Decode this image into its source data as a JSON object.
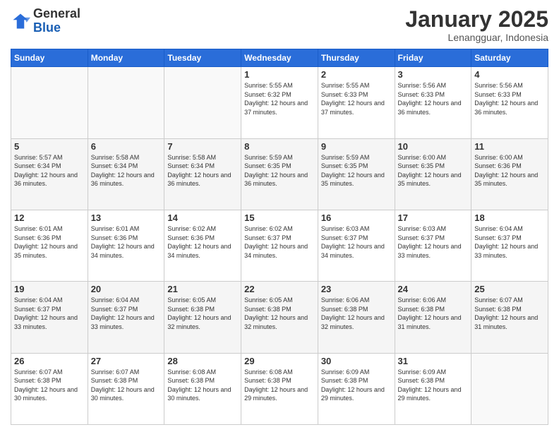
{
  "logo": {
    "general": "General",
    "blue": "Blue"
  },
  "header": {
    "month": "January 2025",
    "location": "Lenangguar, Indonesia"
  },
  "weekdays": [
    "Sunday",
    "Monday",
    "Tuesday",
    "Wednesday",
    "Thursday",
    "Friday",
    "Saturday"
  ],
  "weeks": [
    [
      {
        "day": "",
        "sunrise": "",
        "sunset": "",
        "daylight": ""
      },
      {
        "day": "",
        "sunrise": "",
        "sunset": "",
        "daylight": ""
      },
      {
        "day": "",
        "sunrise": "",
        "sunset": "",
        "daylight": ""
      },
      {
        "day": "1",
        "sunrise": "Sunrise: 5:55 AM",
        "sunset": "Sunset: 6:32 PM",
        "daylight": "Daylight: 12 hours and 37 minutes."
      },
      {
        "day": "2",
        "sunrise": "Sunrise: 5:55 AM",
        "sunset": "Sunset: 6:33 PM",
        "daylight": "Daylight: 12 hours and 37 minutes."
      },
      {
        "day": "3",
        "sunrise": "Sunrise: 5:56 AM",
        "sunset": "Sunset: 6:33 PM",
        "daylight": "Daylight: 12 hours and 36 minutes."
      },
      {
        "day": "4",
        "sunrise": "Sunrise: 5:56 AM",
        "sunset": "Sunset: 6:33 PM",
        "daylight": "Daylight: 12 hours and 36 minutes."
      }
    ],
    [
      {
        "day": "5",
        "sunrise": "Sunrise: 5:57 AM",
        "sunset": "Sunset: 6:34 PM",
        "daylight": "Daylight: 12 hours and 36 minutes."
      },
      {
        "day": "6",
        "sunrise": "Sunrise: 5:58 AM",
        "sunset": "Sunset: 6:34 PM",
        "daylight": "Daylight: 12 hours and 36 minutes."
      },
      {
        "day": "7",
        "sunrise": "Sunrise: 5:58 AM",
        "sunset": "Sunset: 6:34 PM",
        "daylight": "Daylight: 12 hours and 36 minutes."
      },
      {
        "day": "8",
        "sunrise": "Sunrise: 5:59 AM",
        "sunset": "Sunset: 6:35 PM",
        "daylight": "Daylight: 12 hours and 36 minutes."
      },
      {
        "day": "9",
        "sunrise": "Sunrise: 5:59 AM",
        "sunset": "Sunset: 6:35 PM",
        "daylight": "Daylight: 12 hours and 35 minutes."
      },
      {
        "day": "10",
        "sunrise": "Sunrise: 6:00 AM",
        "sunset": "Sunset: 6:35 PM",
        "daylight": "Daylight: 12 hours and 35 minutes."
      },
      {
        "day": "11",
        "sunrise": "Sunrise: 6:00 AM",
        "sunset": "Sunset: 6:36 PM",
        "daylight": "Daylight: 12 hours and 35 minutes."
      }
    ],
    [
      {
        "day": "12",
        "sunrise": "Sunrise: 6:01 AM",
        "sunset": "Sunset: 6:36 PM",
        "daylight": "Daylight: 12 hours and 35 minutes."
      },
      {
        "day": "13",
        "sunrise": "Sunrise: 6:01 AM",
        "sunset": "Sunset: 6:36 PM",
        "daylight": "Daylight: 12 hours and 34 minutes."
      },
      {
        "day": "14",
        "sunrise": "Sunrise: 6:02 AM",
        "sunset": "Sunset: 6:36 PM",
        "daylight": "Daylight: 12 hours and 34 minutes."
      },
      {
        "day": "15",
        "sunrise": "Sunrise: 6:02 AM",
        "sunset": "Sunset: 6:37 PM",
        "daylight": "Daylight: 12 hours and 34 minutes."
      },
      {
        "day": "16",
        "sunrise": "Sunrise: 6:03 AM",
        "sunset": "Sunset: 6:37 PM",
        "daylight": "Daylight: 12 hours and 34 minutes."
      },
      {
        "day": "17",
        "sunrise": "Sunrise: 6:03 AM",
        "sunset": "Sunset: 6:37 PM",
        "daylight": "Daylight: 12 hours and 33 minutes."
      },
      {
        "day": "18",
        "sunrise": "Sunrise: 6:04 AM",
        "sunset": "Sunset: 6:37 PM",
        "daylight": "Daylight: 12 hours and 33 minutes."
      }
    ],
    [
      {
        "day": "19",
        "sunrise": "Sunrise: 6:04 AM",
        "sunset": "Sunset: 6:37 PM",
        "daylight": "Daylight: 12 hours and 33 minutes."
      },
      {
        "day": "20",
        "sunrise": "Sunrise: 6:04 AM",
        "sunset": "Sunset: 6:37 PM",
        "daylight": "Daylight: 12 hours and 33 minutes."
      },
      {
        "day": "21",
        "sunrise": "Sunrise: 6:05 AM",
        "sunset": "Sunset: 6:38 PM",
        "daylight": "Daylight: 12 hours and 32 minutes."
      },
      {
        "day": "22",
        "sunrise": "Sunrise: 6:05 AM",
        "sunset": "Sunset: 6:38 PM",
        "daylight": "Daylight: 12 hours and 32 minutes."
      },
      {
        "day": "23",
        "sunrise": "Sunrise: 6:06 AM",
        "sunset": "Sunset: 6:38 PM",
        "daylight": "Daylight: 12 hours and 32 minutes."
      },
      {
        "day": "24",
        "sunrise": "Sunrise: 6:06 AM",
        "sunset": "Sunset: 6:38 PM",
        "daylight": "Daylight: 12 hours and 31 minutes."
      },
      {
        "day": "25",
        "sunrise": "Sunrise: 6:07 AM",
        "sunset": "Sunset: 6:38 PM",
        "daylight": "Daylight: 12 hours and 31 minutes."
      }
    ],
    [
      {
        "day": "26",
        "sunrise": "Sunrise: 6:07 AM",
        "sunset": "Sunset: 6:38 PM",
        "daylight": "Daylight: 12 hours and 30 minutes."
      },
      {
        "day": "27",
        "sunrise": "Sunrise: 6:07 AM",
        "sunset": "Sunset: 6:38 PM",
        "daylight": "Daylight: 12 hours and 30 minutes."
      },
      {
        "day": "28",
        "sunrise": "Sunrise: 6:08 AM",
        "sunset": "Sunset: 6:38 PM",
        "daylight": "Daylight: 12 hours and 30 minutes."
      },
      {
        "day": "29",
        "sunrise": "Sunrise: 6:08 AM",
        "sunset": "Sunset: 6:38 PM",
        "daylight": "Daylight: 12 hours and 29 minutes."
      },
      {
        "day": "30",
        "sunrise": "Sunrise: 6:09 AM",
        "sunset": "Sunset: 6:38 PM",
        "daylight": "Daylight: 12 hours and 29 minutes."
      },
      {
        "day": "31",
        "sunrise": "Sunrise: 6:09 AM",
        "sunset": "Sunset: 6:38 PM",
        "daylight": "Daylight: 12 hours and 29 minutes."
      },
      {
        "day": "",
        "sunrise": "",
        "sunset": "",
        "daylight": ""
      }
    ]
  ]
}
